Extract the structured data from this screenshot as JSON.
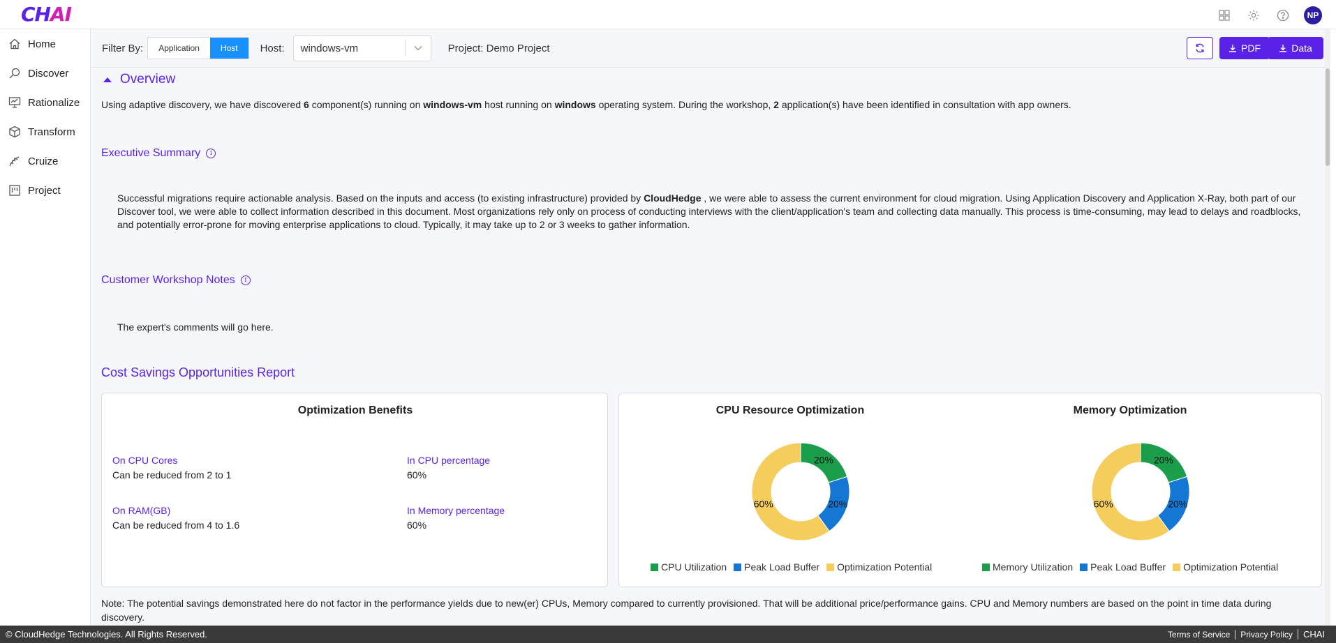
{
  "app": {
    "logo_main": "CH",
    "logo_accent": "AI"
  },
  "topbar": {
    "avatar_initials": "NP"
  },
  "sidebar": {
    "items": [
      {
        "label": "Home",
        "icon": "home-icon"
      },
      {
        "label": "Discover",
        "icon": "discover-icon"
      },
      {
        "label": "Rationalize",
        "icon": "rationalize-icon"
      },
      {
        "label": "Transform",
        "icon": "transform-icon"
      },
      {
        "label": "Cruize",
        "icon": "cruize-icon"
      },
      {
        "label": "Project",
        "icon": "project-icon"
      }
    ]
  },
  "filterbar": {
    "filter_label": "Filter By:",
    "seg_application": "Application",
    "seg_host": "Host",
    "host_label": "Host:",
    "host_value": "windows-vm",
    "project": "Project: Demo Project",
    "pdf_label": "PDF",
    "data_label": "Data"
  },
  "overview": {
    "title": "Overview",
    "t1": "Using adaptive discovery, we have discovered ",
    "count": "6",
    "t2": " component(s) running on ",
    "host": "windows-vm",
    "t3": " host running on ",
    "os": "windows",
    "t4": " operating system. During the workshop, ",
    "apps": "2",
    "t5": " application(s) have been identified in consultation with app owners."
  },
  "executive": {
    "title": "Executive Summary",
    "t1": "Successful migrations require actionable analysis. Based on the inputs and access (to existing infrastructure) provided by ",
    "company": "CloudHedge",
    "t2": " , we were able to assess the current environment for cloud migration. Using Application Discovery and Application X-Ray, both part of our Discover tool, we were able to collect information described in this document. Most organizations rely only on process of conducting interviews with the client/application's team and collecting data manually. This process is time-consuming, may lead to delays and roadblocks, and potentially error-prone for moving enterprise applications to cloud. Typically, it may take up to 2 or 3 weeks to gather information."
  },
  "workshop": {
    "title": "Customer Workshop Notes",
    "comments": "The expert's comments will go here."
  },
  "cost": {
    "title": "Cost Savings Opportunities Report",
    "benefits_title": "Optimization Benefits",
    "metrics": [
      {
        "label": "On CPU Cores",
        "value": "Can be reduced from 2 to 1"
      },
      {
        "label": "In CPU percentage",
        "value": "60%"
      },
      {
        "label": "On RAM(GB)",
        "value": "Can be reduced from 4 to 1.6"
      },
      {
        "label": "In Memory percentage",
        "value": "60%"
      }
    ],
    "note": "Note: The potential savings demonstrated here do not factor in the performance yields due to new(er) CPUs, Memory compared to currently provisioned. That will be additional price/performance gains. CPU and Memory numbers are based on the point in time data during discovery."
  },
  "chart_data": [
    {
      "type": "pie",
      "title": "CPU Resource Optimization",
      "categories": [
        "CPU Utilization",
        "Peak Load Buffer",
        "Optimization Potential"
      ],
      "values": [
        20,
        20,
        60
      ],
      "labels": [
        "20%",
        "20%",
        "60%"
      ],
      "colors": [
        "#1a9e4b",
        "#1577d4",
        "#f5cd5c"
      ],
      "legend": "bottom"
    },
    {
      "type": "pie",
      "title": "Memory Optimization",
      "categories": [
        "Memory Utilization",
        "Peak Load Buffer",
        "Optimization Potential"
      ],
      "values": [
        20,
        20,
        60
      ],
      "labels": [
        "20%",
        "20%",
        "60%"
      ],
      "colors": [
        "#1a9e4b",
        "#1577d4",
        "#f5cd5c"
      ],
      "legend": "bottom"
    }
  ],
  "footer": {
    "copyright": "© CloudHedge Technologies. All Rights Reserved.",
    "terms": "Terms of Service",
    "privacy": "Privacy Policy",
    "brand": "CHAI"
  },
  "colors": {
    "accent": "#5a22e8",
    "selected": "#1890ff"
  }
}
